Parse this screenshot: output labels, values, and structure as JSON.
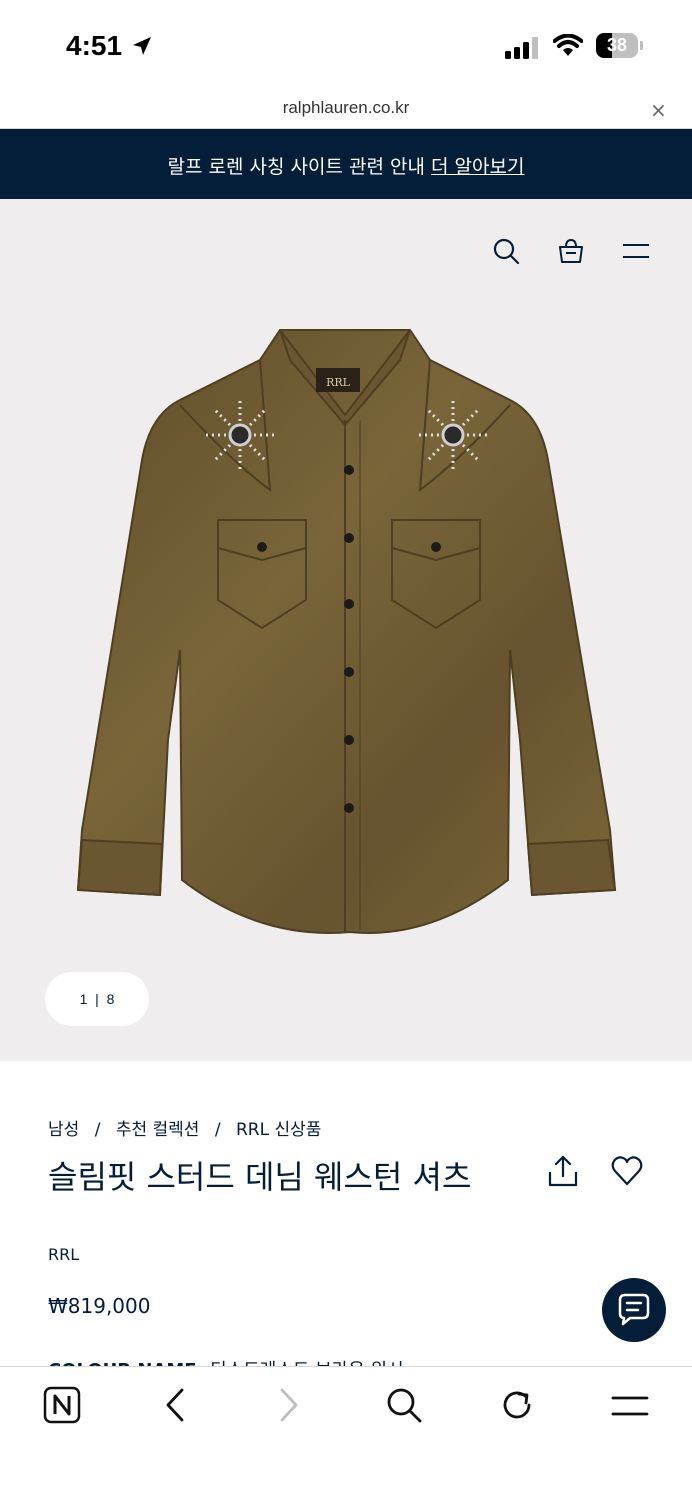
{
  "status": {
    "time": "4:51",
    "battery": "38"
  },
  "browser": {
    "url": "ralphlauren.co.kr",
    "close_label": "×"
  },
  "banner": {
    "text": "랄프 로렌 사칭 사이트 관련 안내",
    "link": "더 알아보기"
  },
  "header_icons": [
    "search-icon",
    "shopping-bag-icon",
    "menu-icon"
  ],
  "gallery": {
    "current": "1",
    "separator": "|",
    "total": "8"
  },
  "breadcrumb": {
    "items": [
      "남성",
      "추천 컬렉션",
      "RRL 신상품"
    ],
    "separator": "/"
  },
  "product": {
    "title": "슬림핏 스터드 데님 웨스턴 셔츠",
    "brand": "RRL",
    "price": "₩819,000",
    "colour_label": "COLOUR NAME:",
    "colour_value": "디스트레스트 브라운 워시"
  },
  "colors": {
    "navy": "#041e3a",
    "hero_bg": "#efeded",
    "shirt": "#6e5a34"
  },
  "toolbar_icons": [
    "naver-home-icon",
    "back-icon",
    "forward-icon",
    "search-icon",
    "reload-icon",
    "menu-icon"
  ]
}
